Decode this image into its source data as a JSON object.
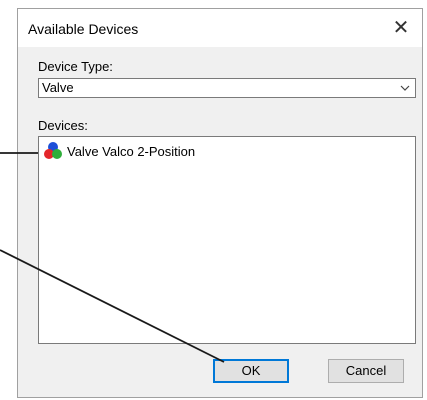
{
  "dialog": {
    "title": "Available Devices",
    "close_icon": "close-icon"
  },
  "device_type": {
    "label": "Device Type:",
    "value": "Valve"
  },
  "devices": {
    "label": "Devices:",
    "items": [
      {
        "label": "Valve Valco 2-Position",
        "icon": "device-rgb-icon"
      }
    ]
  },
  "buttons": {
    "ok": "OK",
    "cancel": "Cancel"
  },
  "colors": {
    "accent": "#0078d7",
    "icon_red": "#e3262b",
    "icon_green": "#2fae3a",
    "icon_blue": "#1c4fd8"
  }
}
